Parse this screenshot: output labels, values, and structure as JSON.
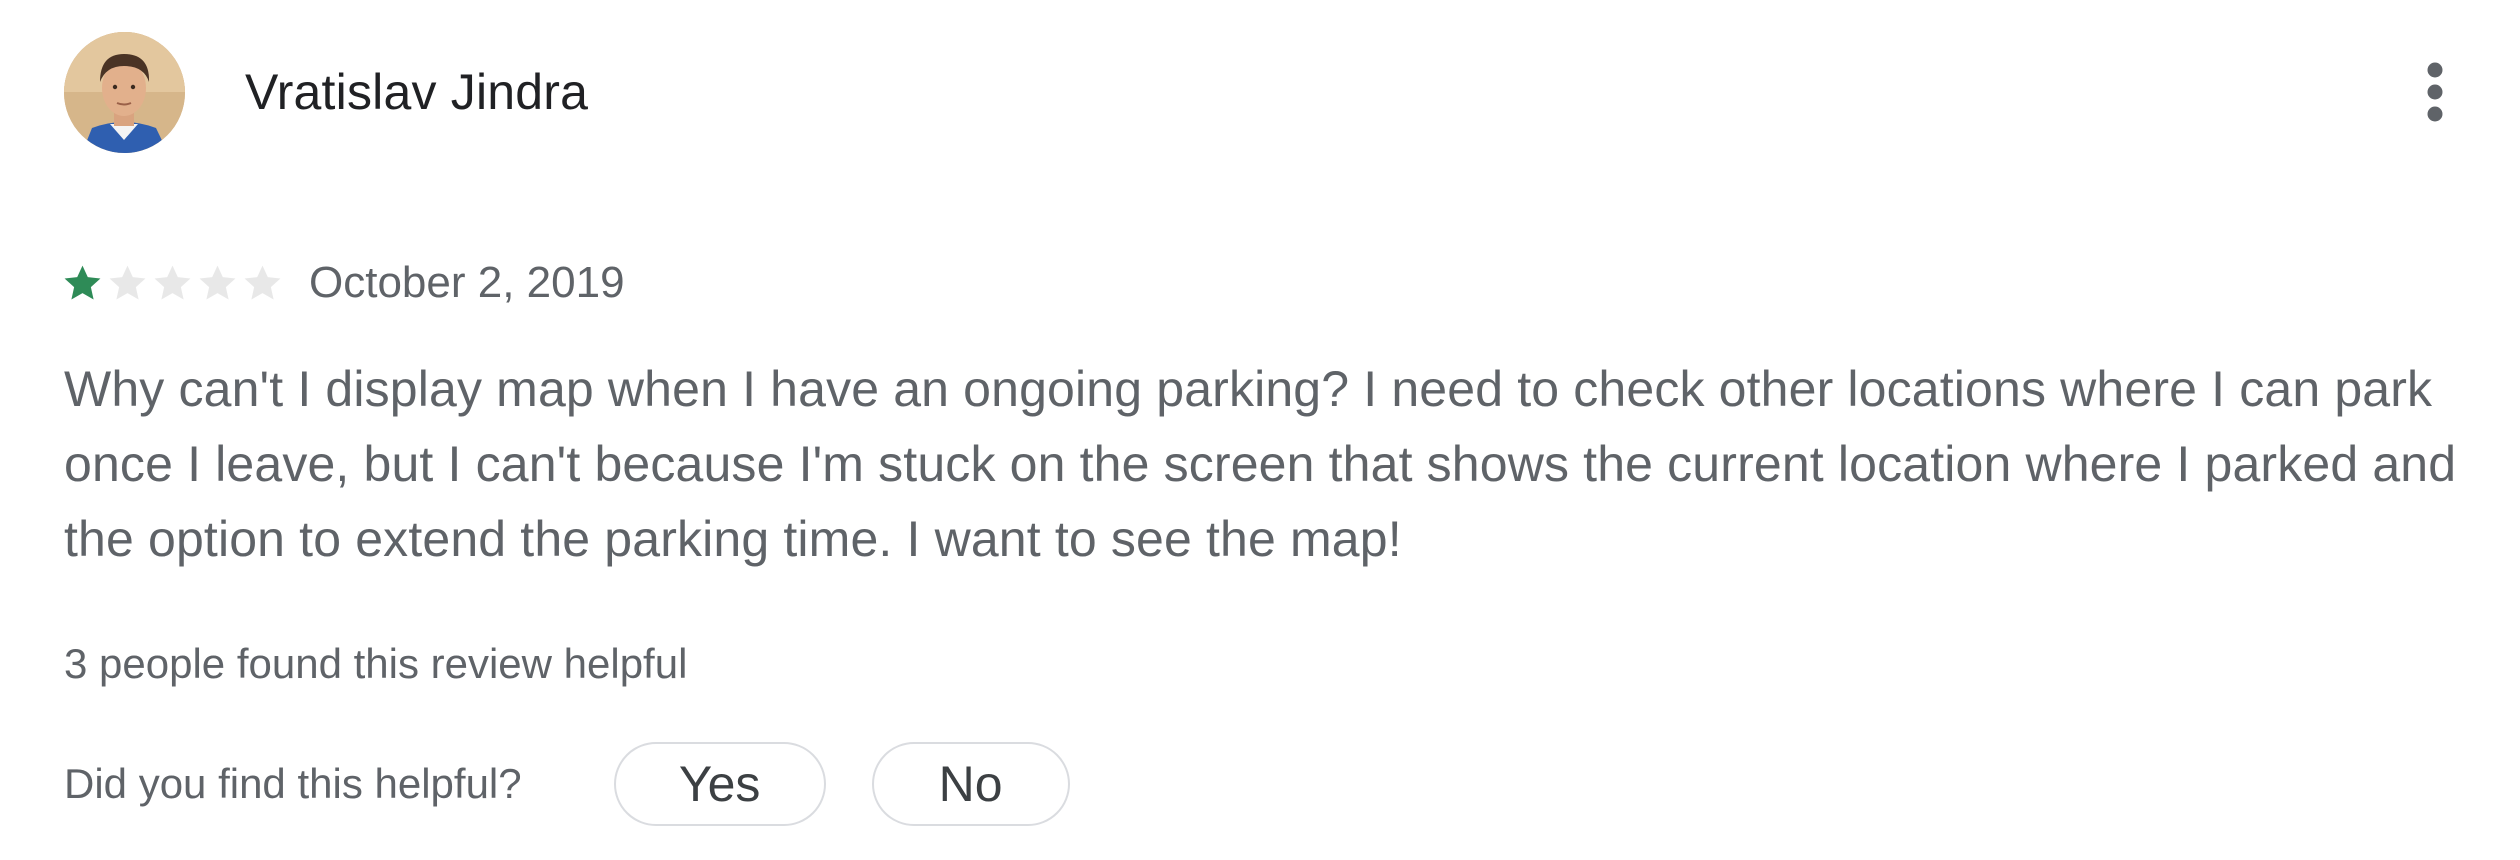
{
  "review": {
    "author": "Vratislav Jindra",
    "rating": 1,
    "rating_max": 5,
    "date": "October 2, 2019",
    "text": "Why can't I display map when I have an ongoing parking? I need to check other locations where I can park once I leave, but I can't because I'm stuck on the screen that shows the current location where I parked and the option to extend the parking time. I want to see the map!",
    "helpful_count_text": "3 people found this review helpful",
    "helpful_question": "Did you find this helpful?",
    "yes_label": "Yes",
    "no_label": "No"
  },
  "icons": {
    "more": "more-vert-icon",
    "star": "star-icon"
  },
  "colors": {
    "star_filled": "#2e8b57",
    "star_empty": "#e8e8e8",
    "author": "#202124",
    "text": "#5f6368",
    "button_border": "#dadce0"
  }
}
